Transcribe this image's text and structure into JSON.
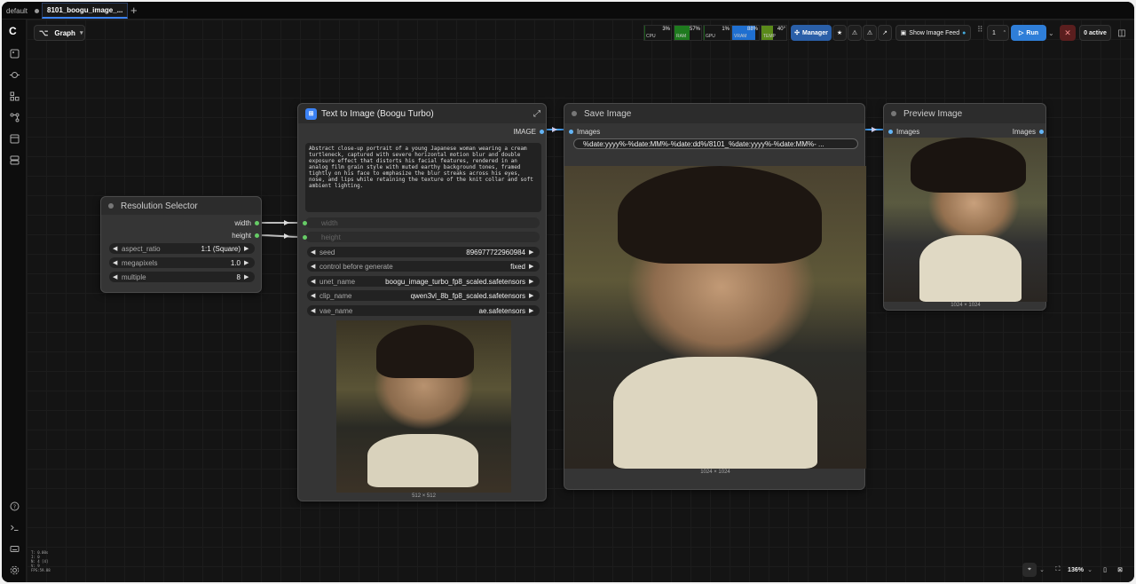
{
  "tabs": [
    {
      "label": "default",
      "active": false
    },
    {
      "label": "8101_boogu_image_...",
      "active": true
    }
  ],
  "toolbar": {
    "graph_label": "Graph",
    "meters": [
      {
        "label": "CPU",
        "value": "3%",
        "color": "#1a5a1a"
      },
      {
        "label": "RAM",
        "value": "57%",
        "color": "#1e7a1e"
      },
      {
        "label": "GPU",
        "value": "1%",
        "color": "#1a5a1a"
      },
      {
        "label": "VRAM",
        "value": "88%",
        "color": "#1f6fd0"
      },
      {
        "label": "TEMP",
        "value": "40°",
        "color": "#5a8a1a"
      }
    ],
    "manager_label": "Manager",
    "image_feed_label": "Show Image Feed",
    "queue_count": "1",
    "run_label": "Run",
    "active_label": "0 active"
  },
  "nodes": {
    "resolution": {
      "title": "Resolution Selector",
      "outputs": [
        "width",
        "height"
      ],
      "widgets": [
        {
          "name": "aspect_ratio",
          "value": "1:1 (Square)"
        },
        {
          "name": "megapixels",
          "value": "1.0"
        },
        {
          "name": "multiple",
          "value": "8"
        }
      ]
    },
    "text_to_image": {
      "title": "Text to Image (Boogu Turbo)",
      "output": "IMAGE",
      "prompt": "Abstract close-up portrait of a young Japanese woman wearing a cream turtleneck, captured with severe horizontal motion blur and double exposure effect that distorts his facial features, rendered in an analog film grain style with muted earthy background tones, framed tightly on his face to emphasize the blur streaks across his eyes, nose, and lips while retaining the texture of the knit collar and soft ambient lighting.",
      "inputs": [
        "width",
        "height"
      ],
      "widgets": [
        {
          "name": "seed",
          "value": "896977722960984"
        },
        {
          "name": "control before generate",
          "value": "fixed"
        },
        {
          "name": "unet_name",
          "value": "boogu_image_turbo_fp8_scaled.safetensors"
        },
        {
          "name": "clip_name",
          "value": "qwen3vl_8b_fp8_scaled.safetensors"
        },
        {
          "name": "vae_name",
          "value": "ae.safetensors"
        }
      ],
      "image_caption": "512 × 512"
    },
    "save_image": {
      "title": "Save Image",
      "input": "Images",
      "filename_prefix": "%date:yyyy%-%date:MM%-%date:dd%/8101_%date:yyyy%-%date:MM%- ...",
      "image_caption": "1024 × 1024"
    },
    "preview_image": {
      "title": "Preview Image",
      "input": "Images",
      "output": "Images",
      "image_caption": "1024 × 1024"
    }
  },
  "bottom_right": {
    "zoom": "136%"
  },
  "stats": [
    "T: 0.00s",
    "I: 0",
    "N: 4 [4]",
    "V: 9",
    "FPS:59.88"
  ]
}
